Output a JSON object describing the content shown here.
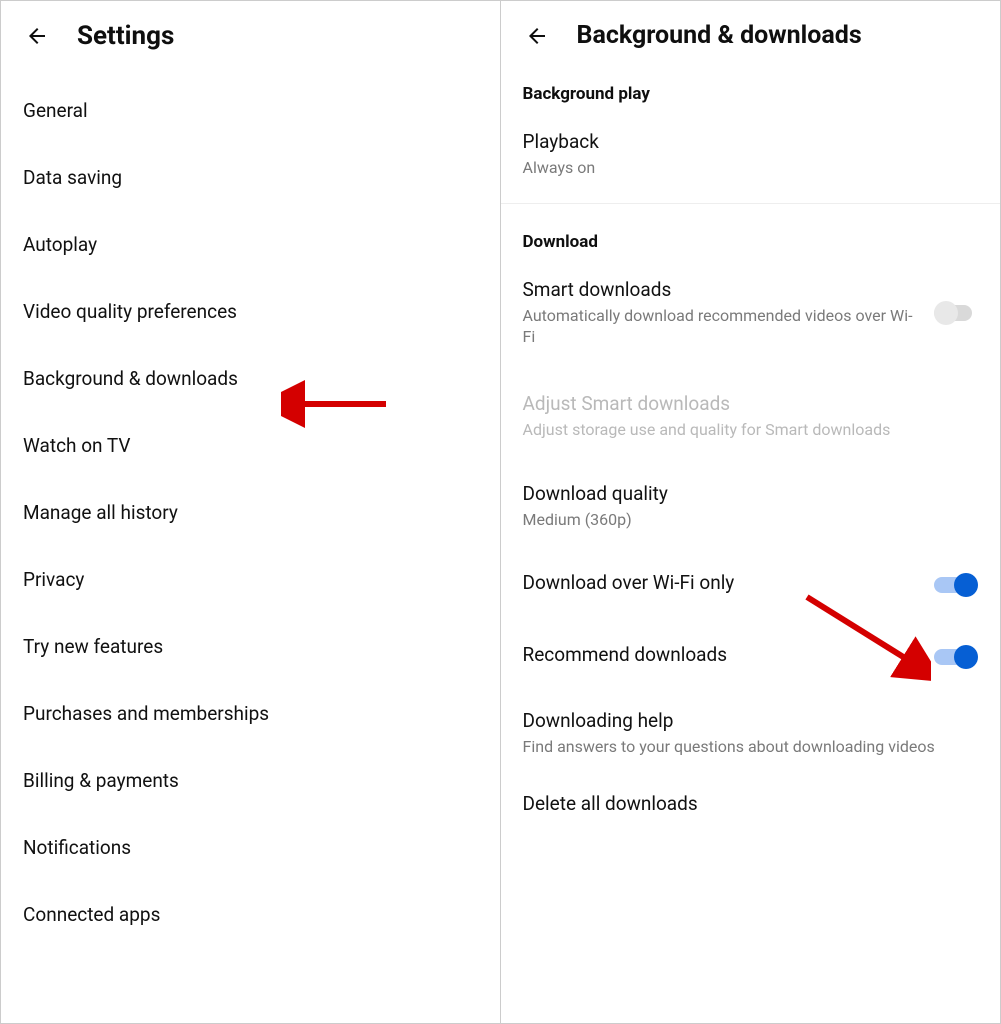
{
  "left": {
    "title": "Settings",
    "items": [
      "General",
      "Data saving",
      "Autoplay",
      "Video quality preferences",
      "Background & downloads",
      "Watch on TV",
      "Manage all history",
      "Privacy",
      "Try new features",
      "Purchases and memberships",
      "Billing & payments",
      "Notifications",
      "Connected apps"
    ]
  },
  "right": {
    "title": "Background & downloads",
    "section_background": "Background play",
    "playback": {
      "title": "Playback",
      "subtitle": "Always on"
    },
    "section_download": "Download",
    "smart_downloads": {
      "title": "Smart downloads",
      "subtitle": "Automatically download recommended videos over Wi-Fi",
      "enabled": false
    },
    "adjust_smart": {
      "title": "Adjust Smart downloads",
      "subtitle": "Adjust storage use and quality for Smart downloads"
    },
    "download_quality": {
      "title": "Download quality",
      "subtitle": "Medium (360p)"
    },
    "wifi_only": {
      "title": "Download over Wi-Fi only",
      "enabled": true
    },
    "recommend": {
      "title": "Recommend downloads",
      "enabled": true
    },
    "help": {
      "title": "Downloading help",
      "subtitle": "Find answers to your questions about downloading videos"
    },
    "delete": {
      "title": "Delete all downloads"
    }
  },
  "annotations": {
    "arrow_color": "#d40000"
  }
}
